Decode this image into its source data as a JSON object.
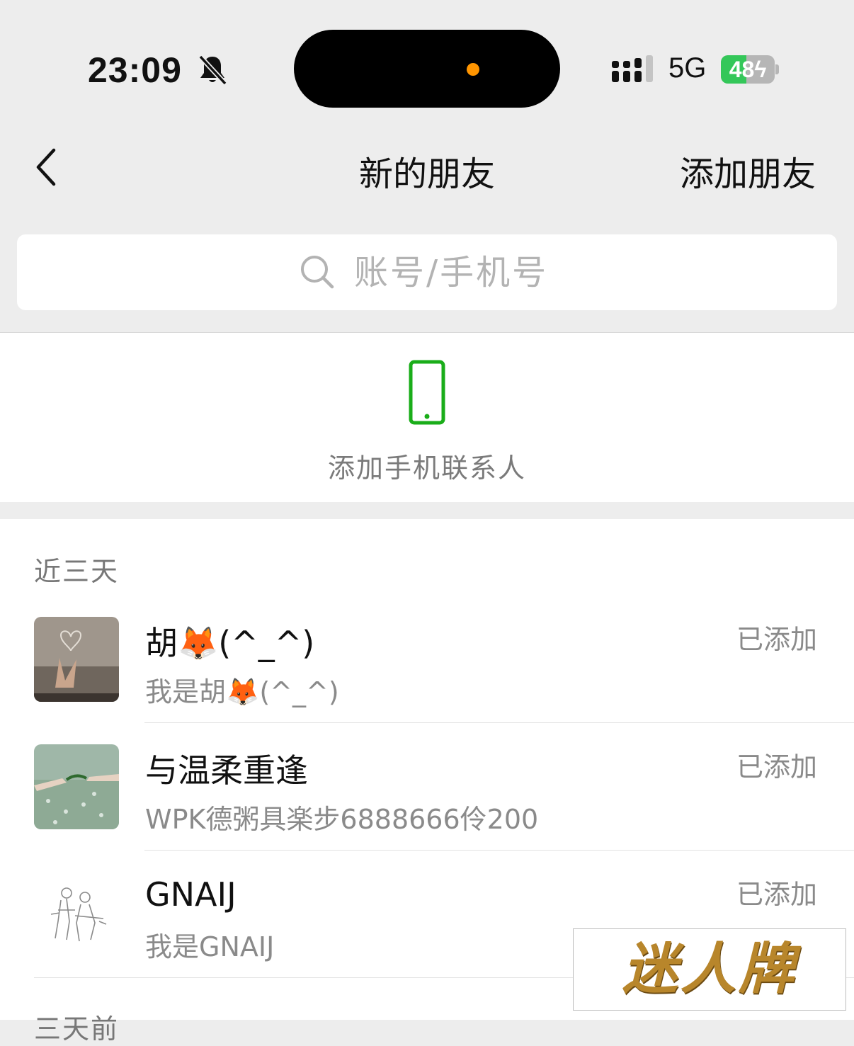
{
  "status_bar": {
    "time": "23:09",
    "network": "5G",
    "battery_level": "48",
    "battery_fraction": 0.48,
    "icons": [
      "bell-slash-icon",
      "signal-icon",
      "battery-charging-icon"
    ]
  },
  "nav": {
    "back_icon": "chevron-left-icon",
    "title": "新的朋友",
    "action_label": "添加朋友"
  },
  "search": {
    "placeholder": "账号/手机号",
    "value": "",
    "icon": "search-icon"
  },
  "phone_contacts": {
    "label": "添加手机联系人",
    "icon": "mobile-phone-icon",
    "color": "#1aad19"
  },
  "sections": [
    {
      "title": "近三天",
      "items": [
        {
          "name": "胡🦊(^_^)",
          "message": "我是胡🦊(^_^)",
          "status": "已添加",
          "avatar": "hand-heart-photo"
        },
        {
          "name": "与温柔重逢",
          "message": "WPK德粥具楽步6888666伶200",
          "status": "已添加",
          "avatar": "meadow-hands-photo"
        },
        {
          "name": "GNAIJ",
          "message": "我是GNAIJ",
          "status": "已添加",
          "avatar": "couple-sketch"
        }
      ]
    },
    {
      "title": "三天前"
    }
  ],
  "watermark": {
    "text": "迷人牌"
  }
}
